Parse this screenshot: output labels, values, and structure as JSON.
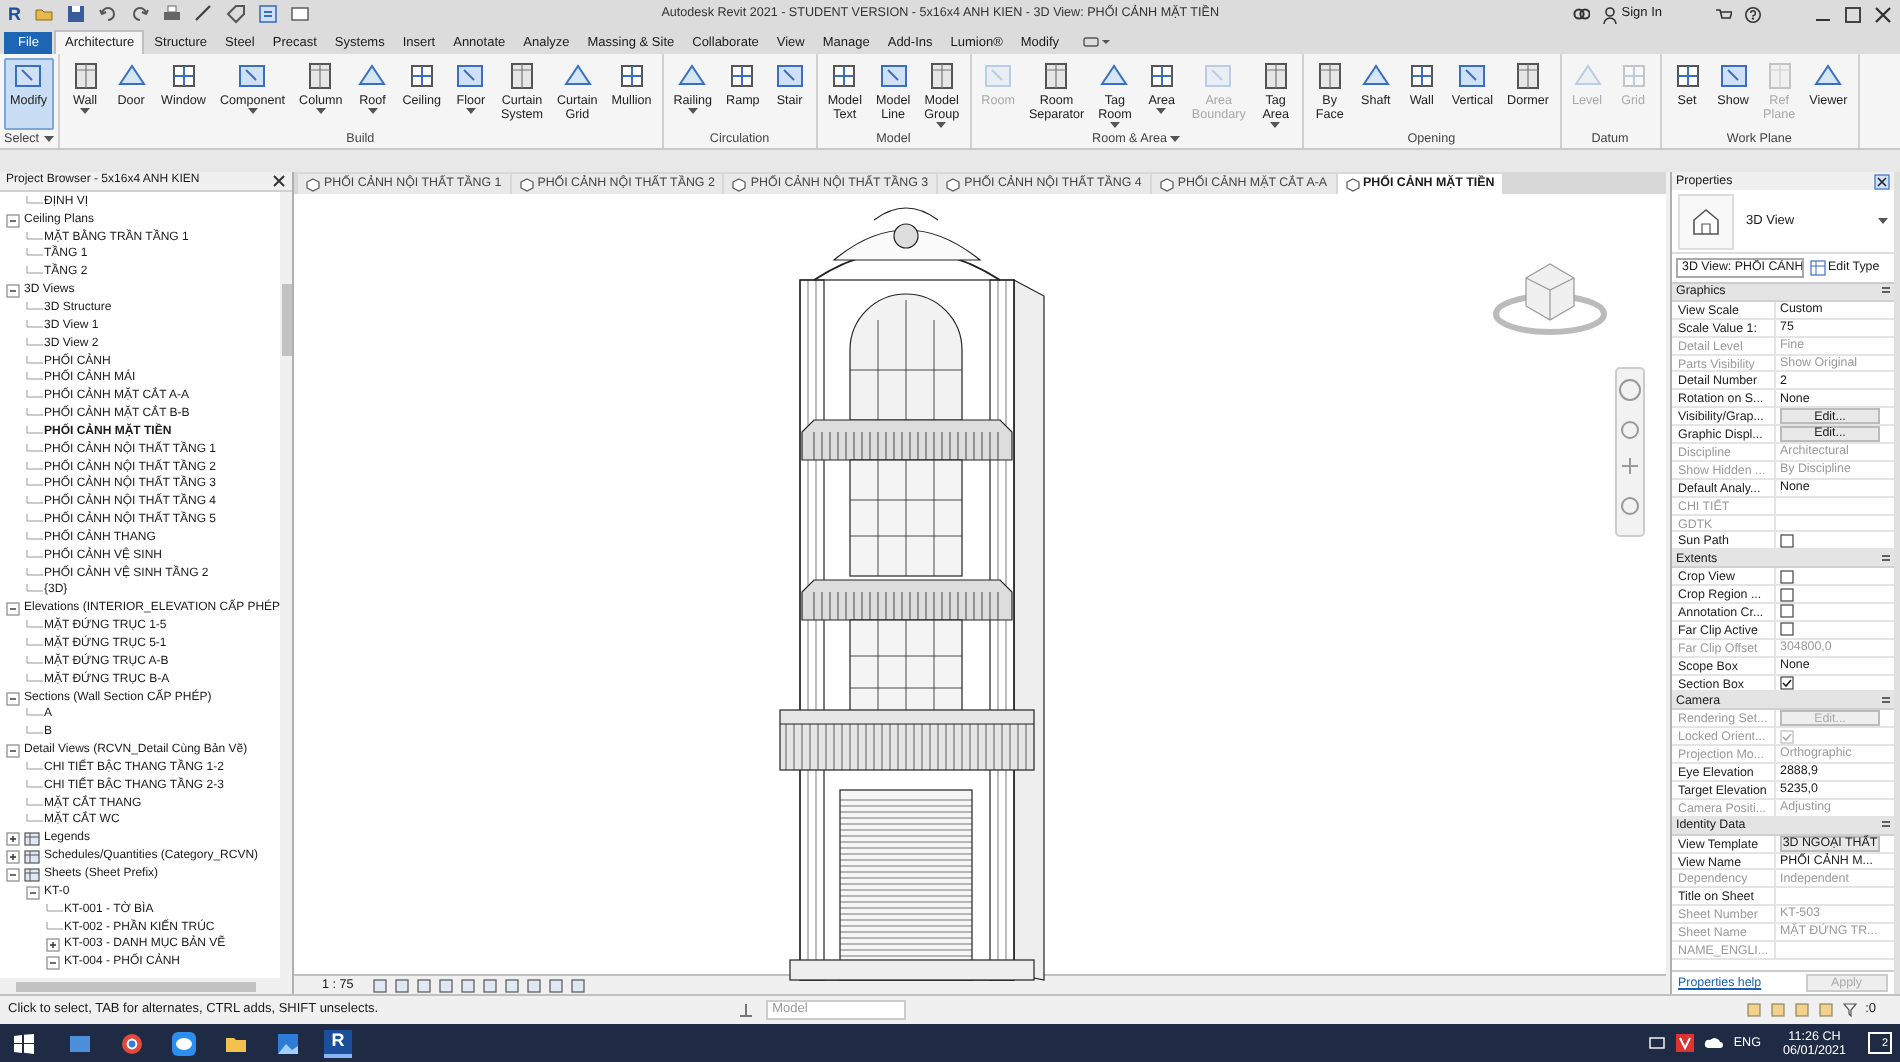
{
  "title_bar": {
    "app_logo": "R",
    "title": "Autodesk Revit 2021 - STUDENT VERSION - 5x16x4 ANH KIEN - 3D View: PHỐI CẢNH MẶT TIỀN",
    "sign_in": "Sign In"
  },
  "ribbon": {
    "tabs": [
      {
        "label": "File",
        "kind": "file",
        "selected": false
      },
      {
        "label": "Architecture",
        "kind": "tab",
        "selected": true
      },
      {
        "label": "Structure",
        "kind": "tab",
        "selected": false
      },
      {
        "label": "Steel",
        "kind": "tab",
        "selected": false
      },
      {
        "label": "Precast",
        "kind": "tab",
        "selected": false
      },
      {
        "label": "Systems",
        "kind": "tab",
        "selected": false
      },
      {
        "label": "Insert",
        "kind": "tab",
        "selected": false
      },
      {
        "label": "Annotate",
        "kind": "tab",
        "selected": false
      },
      {
        "label": "Analyze",
        "kind": "tab",
        "selected": false
      },
      {
        "label": "Massing & Site",
        "kind": "tab",
        "selected": false
      },
      {
        "label": "Collaborate",
        "kind": "tab",
        "selected": false
      },
      {
        "label": "View",
        "kind": "tab",
        "selected": false
      },
      {
        "label": "Manage",
        "kind": "tab",
        "selected": false
      },
      {
        "label": "Add-Ins",
        "kind": "tab",
        "selected": false
      },
      {
        "label": "Lumion®",
        "kind": "tab",
        "selected": false
      },
      {
        "label": "Modify",
        "kind": "tab",
        "selected": false
      }
    ],
    "panels": [
      {
        "label": "Select",
        "dropdown": true,
        "buttons": [
          {
            "label": "Modify",
            "selected": true,
            "disabled": false
          }
        ]
      },
      {
        "label": "Build",
        "buttons": [
          {
            "label": "Wall",
            "selected": false,
            "disabled": false,
            "dropdown": true
          },
          {
            "label": "Door",
            "selected": false,
            "disabled": false
          },
          {
            "label": "Window",
            "selected": false,
            "disabled": false
          },
          {
            "label": "Component",
            "selected": false,
            "disabled": false,
            "dropdown": true
          },
          {
            "label": "Column",
            "selected": false,
            "disabled": false,
            "dropdown": true
          },
          {
            "label": "Roof",
            "selected": false,
            "disabled": false,
            "dropdown": true
          },
          {
            "label": "Ceiling",
            "selected": false,
            "disabled": false
          },
          {
            "label": "Floor",
            "selected": false,
            "disabled": false,
            "dropdown": true
          },
          {
            "label": "Curtain\nSystem",
            "selected": false,
            "disabled": false
          },
          {
            "label": "Curtain\nGrid",
            "selected": false,
            "disabled": false
          },
          {
            "label": "Mullion",
            "selected": false,
            "disabled": false
          }
        ]
      },
      {
        "label": "Circulation",
        "buttons": [
          {
            "label": "Railing",
            "selected": false,
            "disabled": false,
            "dropdown": true
          },
          {
            "label": "Ramp",
            "selected": false,
            "disabled": false
          },
          {
            "label": "Stair",
            "selected": false,
            "disabled": false
          }
        ]
      },
      {
        "label": "Model",
        "buttons": [
          {
            "label": "Model\nText",
            "selected": false,
            "disabled": false
          },
          {
            "label": "Model\nLine",
            "selected": false,
            "disabled": false
          },
          {
            "label": "Model\nGroup",
            "selected": false,
            "disabled": false,
            "dropdown": true
          }
        ]
      },
      {
        "label": "Room & Area",
        "dropdown": true,
        "buttons": [
          {
            "label": "Room",
            "selected": false,
            "disabled": true
          },
          {
            "label": "Room\nSeparator",
            "selected": false,
            "disabled": false
          },
          {
            "label": "Tag\nRoom",
            "selected": false,
            "disabled": false,
            "dropdown": true
          },
          {
            "label": "Area",
            "selected": false,
            "disabled": false,
            "dropdown": true
          },
          {
            "label": "Area\nBoundary",
            "selected": false,
            "disabled": true
          },
          {
            "label": "Tag\nArea",
            "selected": false,
            "disabled": false,
            "dropdown": true
          }
        ]
      },
      {
        "label": "Opening",
        "buttons": [
          {
            "label": "By\nFace",
            "selected": false,
            "disabled": false
          },
          {
            "label": "Shaft",
            "selected": false,
            "disabled": false
          },
          {
            "label": "Wall",
            "selected": false,
            "disabled": false
          },
          {
            "label": "Vertical",
            "selected": false,
            "disabled": false
          },
          {
            "label": "Dormer",
            "selected": false,
            "disabled": false
          }
        ]
      },
      {
        "label": "Datum",
        "buttons": [
          {
            "label": "Level",
            "selected": false,
            "disabled": true
          },
          {
            "label": "Grid",
            "selected": false,
            "disabled": true
          }
        ]
      },
      {
        "label": "Work Plane",
        "buttons": [
          {
            "label": "Set",
            "selected": false,
            "disabled": false
          },
          {
            "label": "Show",
            "selected": false,
            "disabled": false
          },
          {
            "label": "Ref\nPlane",
            "selected": false,
            "disabled": true
          },
          {
            "label": "Viewer",
            "selected": false,
            "disabled": false
          }
        ]
      }
    ]
  },
  "project_browser": {
    "title": "Project Browser - 5x16x4 ANH KIEN",
    "tree": [
      {
        "children": [
          {
            "label": "ĐỊNH VỊ",
            "selected": false
          }
        ]
      },
      {
        "label": "Ceiling Plans",
        "kind": "group",
        "expanded": true,
        "selected": false,
        "children": [
          {
            "label": "MẶT BẰNG TRẦN TẦNG 1",
            "selected": false
          },
          {
            "label": "TẦNG 1",
            "selected": false
          },
          {
            "label": "TẦNG 2",
            "selected": false
          }
        ]
      },
      {
        "label": "3D Views",
        "kind": "group",
        "expanded": true,
        "selected": false,
        "children": [
          {
            "label": "3D Structure",
            "selected": false
          },
          {
            "label": "3D View 1",
            "selected": false
          },
          {
            "label": "3D View 2",
            "selected": false
          },
          {
            "label": "PHỐI CẢNH",
            "selected": false
          },
          {
            "label": "PHỐI CẢNH MÁI",
            "selected": false
          },
          {
            "label": "PHỐI CẢNH MẶT CẮT A-A",
            "selected": false
          },
          {
            "label": "PHỐI CẢNH MẶT CẮT B-B",
            "selected": false
          },
          {
            "label": "PHỐI CẢNH MẶT TIỀN",
            "selected": true
          },
          {
            "label": "PHỐI CẢNH NỘI THẤT TẦNG 1",
            "selected": false
          },
          {
            "label": "PHỐI CẢNH NỘI THẤT TẦNG 2",
            "selected": false
          },
          {
            "label": "PHỐI CẢNH NỘI THẤT TẦNG 3",
            "selected": false
          },
          {
            "label": "PHỐI CẢNH NỘI THẤT TẦNG 4",
            "selected": false
          },
          {
            "label": "PHỐI CẢNH NỘI THẤT TẦNG 5",
            "selected": false
          },
          {
            "label": "PHỐI CẢNH THANG",
            "selected": false
          },
          {
            "label": "PHỐI CẢNH VỆ SINH",
            "selected": false
          },
          {
            "label": "PHỐI CẢNH VỆ SINH TẦNG 2",
            "selected": false
          },
          {
            "label": "{3D}",
            "selected": false
          }
        ]
      },
      {
        "label": "Elevations (INTERIOR_ELEVATION CẤP PHÉP",
        "kind": "group",
        "expanded": true,
        "selected": false,
        "children": [
          {
            "label": "MẶT ĐỨNG TRỤC 1-5",
            "selected": false
          },
          {
            "label": "MẶT ĐỨNG TRỤC 5-1",
            "selected": false
          },
          {
            "label": "MẶT ĐỨNG TRỤC A-B",
            "selected": false
          },
          {
            "label": "MẶT ĐỨNG TRỤC B-A",
            "selected": false
          }
        ]
      },
      {
        "label": "Sections (Wall Section CẤP PHÉP)",
        "kind": "group",
        "expanded": true,
        "selected": false,
        "children": [
          {
            "label": "A",
            "selected": false
          },
          {
            "label": "B",
            "selected": false
          }
        ]
      },
      {
        "label": "Detail Views (RCVN_Detail Cùng Bản Vẽ)",
        "kind": "group",
        "expanded": true,
        "selected": false,
        "children": [
          {
            "label": "CHI TIẾT BẬC THANG TẦNG 1-2",
            "selected": false
          },
          {
            "label": "CHI TIẾT BẬC THANG TẦNG 2-3",
            "selected": false
          },
          {
            "label": "MẶT CẮT THANG",
            "selected": false
          },
          {
            "label": "MẶT CẮT WC",
            "selected": false
          }
        ]
      },
      {
        "label": "Legends",
        "kind": "category",
        "expanded": false,
        "selected": false
      },
      {
        "label": "Schedules/Quantities (Category_RCVN)",
        "kind": "category",
        "expanded": false,
        "selected": false
      },
      {
        "label": "Sheets (Sheet Prefix)",
        "kind": "category",
        "expanded": true,
        "selected": false,
        "children": [
          {
            "label": "KT-0",
            "expanded": true,
            "selected": false,
            "children": [
              {
                "label": "KT-001 - TỜ BÌA",
                "selected": false
              },
              {
                "label": "KT-002 - PHẦN KIẾN TRÚC",
                "selected": false
              },
              {
                "label": "KT-003 - DANH MỤC BẢN VẼ",
                "expanded": false,
                "selected": false
              },
              {
                "label": "KT-004 - PHỐI CẢNH",
                "expanded": true,
                "selected": false
              }
            ]
          }
        ]
      }
    ]
  },
  "view_tabs": [
    {
      "label": "PHỐI CẢNH NỘI THẤT TẦNG 1",
      "selected": false
    },
    {
      "label": "PHỐI CẢNH NỘI THẤT TẦNG 2",
      "selected": false
    },
    {
      "label": "PHỐI CẢNH NỘI THẤT TẦNG 3",
      "selected": false
    },
    {
      "label": "PHỐI CẢNH NỘI THẤT TẦNG 4",
      "selected": false
    },
    {
      "label": "PHỐI CẢNH MẶT CẮT A-A",
      "selected": false
    },
    {
      "label": "PHỐI CẢNH MẶT TIỀN",
      "selected": true
    }
  ],
  "view_control_bar": {
    "scale": "1 : 75"
  },
  "properties": {
    "title": "Properties",
    "type_name": "3D View",
    "instance": "3D View: PHỐI CẢNH",
    "edit_type": "Edit Type",
    "groups": [
      {
        "label": "Graphics",
        "rows": [
          {
            "name": "View Scale",
            "kind": "text",
            "value": "Custom",
            "disabled": false
          },
          {
            "name": "Scale Value    1:",
            "kind": "text",
            "value": "75",
            "disabled": false
          },
          {
            "name": "Detail Level",
            "kind": "text",
            "value": "Fine",
            "disabled": true
          },
          {
            "name": "Parts Visibility",
            "kind": "text",
            "value": "Show Original",
            "disabled": true
          },
          {
            "name": "Detail Number",
            "kind": "text",
            "value": "2",
            "disabled": false
          },
          {
            "name": "Rotation on S...",
            "kind": "text",
            "value": "None",
            "disabled": false
          },
          {
            "name": "Visibility/Grap...",
            "kind": "button",
            "value": "Edit...",
            "disabled": false
          },
          {
            "name": "Graphic Displ...",
            "kind": "button",
            "value": "Edit...",
            "disabled": false
          },
          {
            "name": "Discipline",
            "kind": "text",
            "value": "Architectural",
            "disabled": true
          },
          {
            "name": "Show Hidden ...",
            "kind": "text",
            "value": "By Discipline",
            "disabled": true
          },
          {
            "name": "Default Analy...",
            "kind": "text",
            "value": "None",
            "disabled": false
          },
          {
            "name": "CHI TIẾT",
            "kind": "text",
            "disabled": true
          },
          {
            "name": "GDTK",
            "kind": "text",
            "disabled": true
          },
          {
            "name": "Sun Path",
            "kind": "check",
            "checked": false,
            "disabled": false
          }
        ]
      },
      {
        "label": "Extents",
        "rows": [
          {
            "name": "Crop View",
            "kind": "check",
            "checked": false,
            "disabled": false
          },
          {
            "name": "Crop Region ...",
            "kind": "check",
            "checked": false,
            "disabled": false
          },
          {
            "name": "Annotation Cr...",
            "kind": "check",
            "checked": false,
            "disabled": false
          },
          {
            "name": "Far Clip Active",
            "kind": "check",
            "checked": false,
            "disabled": false
          },
          {
            "name": "Far Clip Offset",
            "kind": "text",
            "value": "304800,0",
            "disabled": true
          },
          {
            "name": "Scope Box",
            "kind": "text",
            "value": "None",
            "disabled": false
          },
          {
            "name": "Section Box",
            "kind": "check",
            "checked": true,
            "disabled": false
          }
        ]
      },
      {
        "label": "Camera",
        "rows": [
          {
            "name": "Rendering Set...",
            "kind": "button",
            "value": "Edit...",
            "disabled": true
          },
          {
            "name": "Locked Orient...",
            "kind": "check",
            "checked": true,
            "disabled": true
          },
          {
            "name": "Projection Mo...",
            "kind": "text",
            "value": "Orthographic",
            "disabled": true
          },
          {
            "name": "Eye Elevation",
            "kind": "text",
            "value": "2888,9",
            "disabled": false
          },
          {
            "name": "Target Elevation",
            "kind": "text",
            "value": "5235,0",
            "disabled": false
          },
          {
            "name": "Camera Positi...",
            "kind": "text",
            "value": "Adjusting",
            "disabled": true
          }
        ]
      },
      {
        "label": "Identity Data",
        "rows": [
          {
            "name": "View Template",
            "kind": "button",
            "value": "3D NGOẠI THẤT",
            "disabled": false
          },
          {
            "name": "View Name",
            "kind": "text",
            "value": "PHỐI CẢNH M...",
            "disabled": false
          },
          {
            "name": "Dependency",
            "kind": "text",
            "value": "Independent",
            "disabled": true
          },
          {
            "name": "Title on Sheet",
            "kind": "text",
            "disabled": false
          },
          {
            "name": "Sheet Number",
            "kind": "text",
            "value": "KT-503",
            "disabled": true
          },
          {
            "name": "Sheet Name",
            "kind": "text",
            "value": "MẶT ĐỨNG TR...",
            "disabled": true
          },
          {
            "name": "NAME_ENGLI...",
            "kind": "text",
            "disabled": true
          }
        ]
      }
    ],
    "help": "Properties help",
    "apply": "Apply",
    "apply_disabled": true
  },
  "status_bar": {
    "message": "Click to select, TAB for alternates, CTRL adds, SHIFT unselects.",
    "model": "Model",
    "filter_count": ":0"
  },
  "taskbar": {
    "revit_logo": "R",
    "language": "ENG",
    "time": "11:26 CH",
    "date": "06/01/2021",
    "notifications": "2"
  }
}
